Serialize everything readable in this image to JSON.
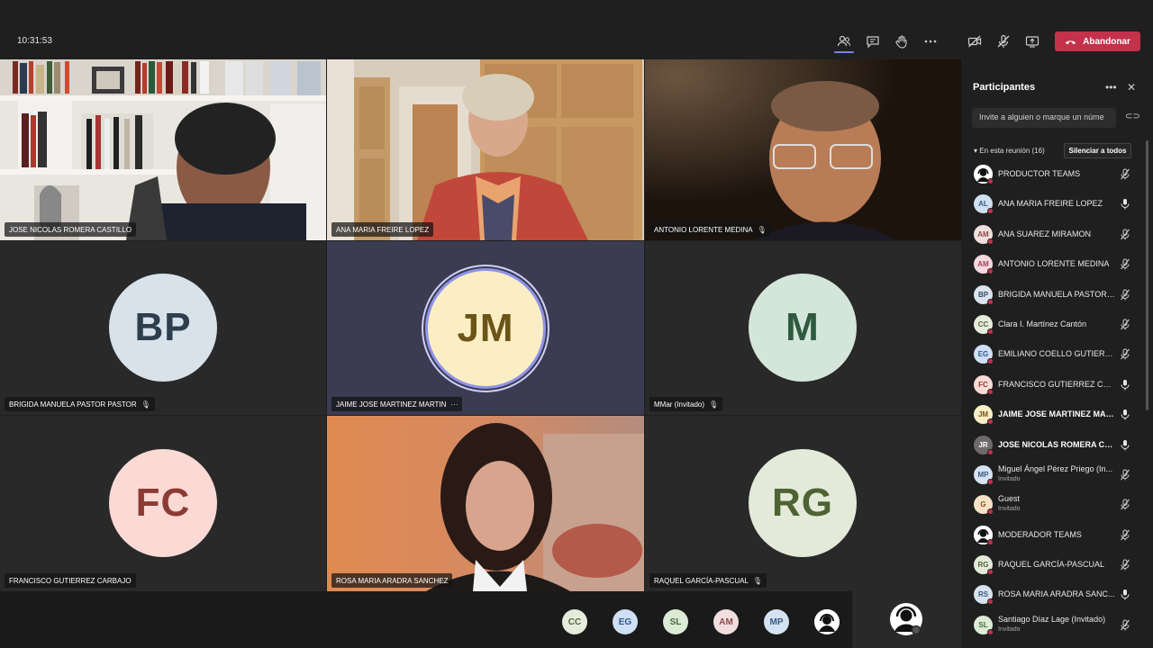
{
  "header": {
    "clock": "10:31:53",
    "leave_label": "Abandonar",
    "icons": [
      "people-icon",
      "chat-icon",
      "raise-hand-icon",
      "more-icon",
      "camera-off-icon",
      "mic-off-icon",
      "share-screen-icon",
      "hang-up-icon"
    ]
  },
  "tiles": [
    {
      "name": "JOSE NICOLAS ROMERA CASTILLO",
      "mic": "",
      "kind": "video"
    },
    {
      "name": "ANA MARIA FREIRE LOPEZ",
      "mic": "",
      "kind": "video"
    },
    {
      "name": "ANTONIO LORENTE MEDINA",
      "mic": "🎙",
      "kind": "video"
    },
    {
      "name": "BRIGIDA MANUELA PASTOR PASTOR",
      "mic": "🎙",
      "kind": "avatar",
      "initials": "BP"
    },
    {
      "name": "JAIME JOSE MARTINEZ MARTIN",
      "mic": "···",
      "kind": "avatar",
      "initials": "JM"
    },
    {
      "name": "MMar (Invitado)",
      "mic": "🎙",
      "kind": "avatar",
      "initials": "M"
    },
    {
      "name": "FRANCISCO GUTIERREZ CARBAJO",
      "mic": "",
      "kind": "avatar",
      "initials": "FC"
    },
    {
      "name": "ROSA MARIA ARADRA SANCHEZ",
      "mic": "",
      "kind": "video"
    },
    {
      "name": "RAQUEL GARCÍA-PASCUAL",
      "mic": "🎙",
      "kind": "avatar",
      "initials": "RG"
    }
  ],
  "panel": {
    "title": "Participantes",
    "invite_placeholder": "Invite a alguien o marque un núme",
    "section": "En esta reunión (16)",
    "mute_all": "Silenciar a todos",
    "participants": [
      {
        "initials": "",
        "name": "PRODUCTOR TEAMS",
        "sub": "",
        "muted": true,
        "bold": false,
        "bg": "#ffffff",
        "fg": "#000000"
      },
      {
        "initials": "AL",
        "name": "ANA MARIA FREIRE LOPEZ",
        "sub": "",
        "muted": false,
        "bold": false,
        "bg": "#cfe0f1",
        "fg": "#3a5a80"
      },
      {
        "initials": "AM",
        "name": "ANA SUAREZ MIRAMON",
        "sub": "",
        "muted": true,
        "bold": false,
        "bg": "#f1dede",
        "fg": "#8a4b4b"
      },
      {
        "initials": "AM",
        "name": "ANTONIO LORENTE MEDINA",
        "sub": "",
        "muted": true,
        "bold": false,
        "bg": "#f6d8e0",
        "fg": "#a0435c"
      },
      {
        "initials": "BP",
        "name": "BRIGIDA MANUELA PASTOR P...",
        "sub": "",
        "muted": true,
        "bold": false,
        "bg": "#dbe4ee",
        "fg": "#354a5f"
      },
      {
        "initials": "CC",
        "name": "Clara I. Martínez Cantón",
        "sub": "",
        "muted": true,
        "bold": false,
        "bg": "#e6ecdc",
        "fg": "#56683a"
      },
      {
        "initials": "EG",
        "name": "EMILIANO COELLO GUTIERREZ",
        "sub": "",
        "muted": true,
        "bold": false,
        "bg": "#cfdff4",
        "fg": "#34598c"
      },
      {
        "initials": "FC",
        "name": "FRANCISCO GUTIERREZ CARB...",
        "sub": "",
        "muted": false,
        "bold": false,
        "bg": "#fbdad6",
        "fg": "#8b3b33"
      },
      {
        "initials": "JM",
        "name": "JAIME JOSE MARTINEZ MAR...",
        "sub": "",
        "muted": false,
        "bold": true,
        "bg": "#fbeec5",
        "fg": "#6b5418"
      },
      {
        "initials": "JR",
        "name": "JOSE NICOLAS ROMERA CAS...",
        "sub": "",
        "muted": false,
        "bold": true,
        "bg": "#6f6a6a",
        "fg": "#ffffff"
      },
      {
        "initials": "MP",
        "name": "Miguel Ángel Pérez Priego (In...",
        "sub": "Invitado",
        "muted": true,
        "bold": false,
        "bg": "#d4e2f2",
        "fg": "#3a5a80"
      },
      {
        "initials": "G",
        "name": "Guest",
        "sub": "Invitado",
        "muted": true,
        "bold": false,
        "bg": "#f7e2c6",
        "fg": "#7a5526"
      },
      {
        "initials": "",
        "name": "MODERADOR TEAMS",
        "sub": "",
        "muted": true,
        "bold": false,
        "bg": "#ffffff",
        "fg": "#000000"
      },
      {
        "initials": "RG",
        "name": "RAQUEL GARCÍA-PASCUAL",
        "sub": "",
        "muted": true,
        "bold": false,
        "bg": "#e3ead9",
        "fg": "#4e6234"
      },
      {
        "initials": "RS",
        "name": "ROSA MARIA ARADRA SANC...",
        "sub": "",
        "muted": false,
        "bold": false,
        "bg": "#d7e4ef",
        "fg": "#3a5a80"
      },
      {
        "initials": "SL",
        "name": "Santiago Díaz Lage (Invitado)",
        "sub": "Invitado",
        "muted": true,
        "bold": false,
        "bg": "#dcebd5",
        "fg": "#4a6b3a"
      }
    ]
  },
  "overflow": [
    {
      "initials": "CC",
      "bg": "#e6ecdc",
      "fg": "#56683a"
    },
    {
      "initials": "EG",
      "bg": "#cfdff4",
      "fg": "#34598c"
    },
    {
      "initials": "SL",
      "bg": "#dcebd5",
      "fg": "#4a6b3a"
    },
    {
      "initials": "AM",
      "bg": "#f1dede",
      "fg": "#8a4b4b"
    },
    {
      "initials": "MP",
      "bg": "#d4e2f2",
      "fg": "#3a5a80"
    },
    {
      "initials": "",
      "bg": "#ffffff",
      "fg": "#000000"
    }
  ]
}
